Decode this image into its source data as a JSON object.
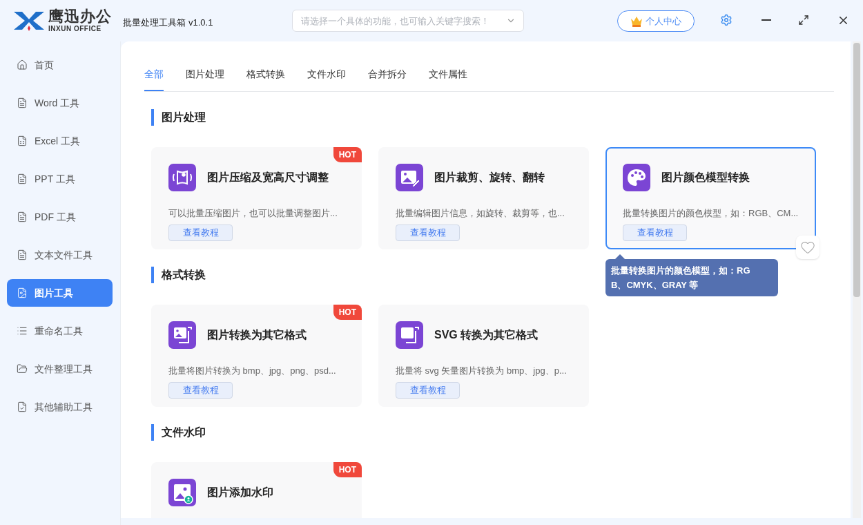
{
  "logo": {
    "name": "鹰迅办公",
    "subtitle": "INXUN OFFICE"
  },
  "window": {
    "title": "批量处理工具箱 v1.0.1"
  },
  "search": {
    "placeholder": "请选择一个具体的功能，也可输入关键字搜索！"
  },
  "account_button": {
    "label": "个人中心"
  },
  "sidebar": {
    "items": [
      {
        "label": "首页",
        "selected": false
      },
      {
        "label": "Word 工具",
        "selected": false
      },
      {
        "label": "Excel 工具",
        "selected": false
      },
      {
        "label": "PPT 工具",
        "selected": false
      },
      {
        "label": "PDF 工具",
        "selected": false
      },
      {
        "label": "文本文件工具",
        "selected": false
      },
      {
        "label": "图片工具",
        "selected": true
      },
      {
        "label": "重命名工具",
        "selected": false
      },
      {
        "label": "文件整理工具",
        "selected": false
      },
      {
        "label": "其他辅助工具",
        "selected": false
      }
    ]
  },
  "tabs": [
    {
      "label": "全部",
      "selected": true
    },
    {
      "label": "图片处理",
      "selected": false
    },
    {
      "label": "格式转换",
      "selected": false
    },
    {
      "label": "文件水印",
      "selected": false
    },
    {
      "label": "合并拆分",
      "selected": false
    },
    {
      "label": "文件属性",
      "selected": false
    }
  ],
  "sections": [
    {
      "title": "图片处理",
      "cards": [
        {
          "kind": "resize",
          "title": "图片压缩及宽高尺寸调整",
          "description": "可以批量压缩图片，也可以批量调整图片...",
          "button": "查看教程",
          "badge": "HOT",
          "hovered": false
        },
        {
          "kind": "edit",
          "title": "图片裁剪、旋转、翻转",
          "description": "批量编辑图片信息，如旋转、裁剪等，也...",
          "button": "查看教程",
          "hovered": false
        },
        {
          "kind": "palette",
          "title": "图片颜色模型转换",
          "description": "批量转换图片的颜色模型，如：RGB、CM...",
          "button": "查看教程",
          "hovered": true
        }
      ]
    },
    {
      "title": "格式转换",
      "cards": [
        {
          "kind": "convert",
          "title": "图片转换为其它格式",
          "description": "批量将图片转换为 bmp、jpg、png、psd...",
          "button": "查看教程",
          "badge": "HOT",
          "hovered": false
        },
        {
          "kind": "svg",
          "title": "SVG 转换为其它格式",
          "description": "批量将 svg 矢量图片转换为 bmp、jpg、p...",
          "button": "查看教程",
          "hovered": false
        }
      ]
    },
    {
      "title": "文件水印",
      "cards": [
        {
          "kind": "watermark",
          "title": "图片添加水印",
          "badge": "HOT",
          "hovered": false
        }
      ]
    }
  ],
  "tooltip": {
    "text": "批量转换图片的颜色模型，如：RGB、CMYK、GRAY 等"
  }
}
